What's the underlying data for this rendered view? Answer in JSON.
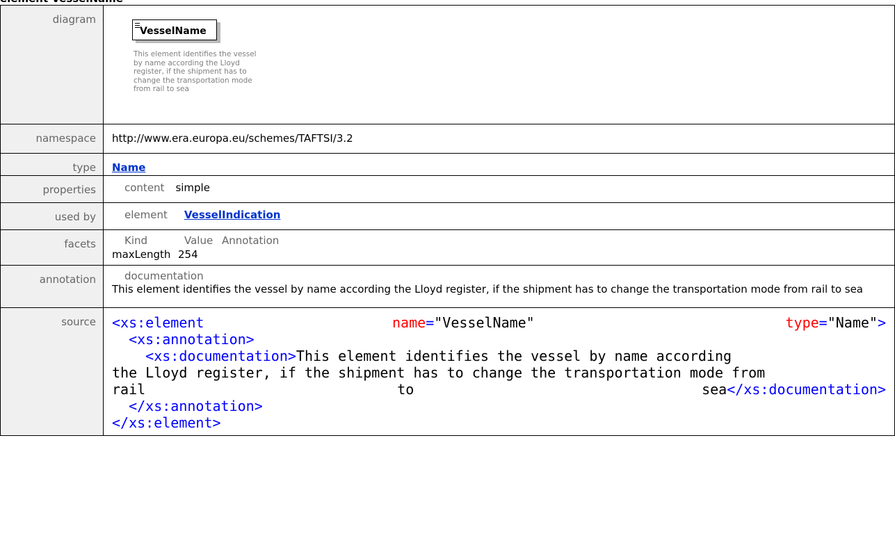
{
  "page_title": "element VesselName",
  "diagram": {
    "label": "diagram",
    "element_name": "VesselName",
    "description": "This element identifies the vessel by name according the Lloyd register, if the shipment has to change the transportation mode from rail to sea"
  },
  "namespace": {
    "label": "namespace",
    "value": "http://www.era.europa.eu/schemes/TAFTSI/3.2"
  },
  "type": {
    "label": "type",
    "value": "Name"
  },
  "properties": {
    "label": "properties",
    "key": "content",
    "value": "simple"
  },
  "used_by": {
    "label": "used by",
    "key": "element",
    "value": "VesselIndication"
  },
  "facets": {
    "label": "facets",
    "headers": [
      "Kind",
      "Value",
      "Annotation"
    ],
    "rows": [
      {
        "kind": "maxLength",
        "value": "254",
        "annotation": ""
      }
    ]
  },
  "annotation": {
    "label": "annotation",
    "sub": "documentation",
    "text": "This element identifies the vessel by name according the Lloyd register, if the shipment has to change the transportation mode from rail to sea"
  },
  "source": {
    "label": "source",
    "line1_open": "<xs:element",
    "name_attr": "name",
    "name_val": "\"VesselName\"",
    "type_attr": "type",
    "type_val": "\"Name\"",
    "line2": "<xs:annotation>",
    "line3_tag": "<xs:documentation>",
    "line3_text": "This element identifies the vessel by name according",
    "line4": "the Lloyd register, if the shipment has to change the transportation mode from",
    "line5_a": "rail",
    "line5_b": "to",
    "line5_c": "sea",
    "line5_close": "</xs:documentation>",
    "line6": "</xs:annotation>",
    "line7": "</xs:element>"
  }
}
